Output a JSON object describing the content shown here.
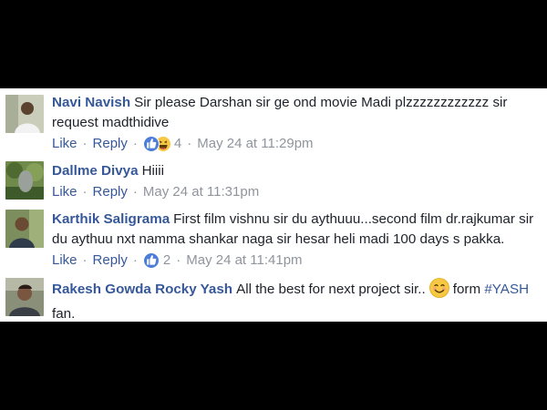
{
  "comments": [
    {
      "author": "Navi Navish",
      "text": "Sir please Darshan sir ge ond movie Madi plzzzzzzzzzzzz sir request madthidive",
      "like": "Like",
      "reply": "Reply",
      "reactions": [
        "like-icon",
        "haha-icon"
      ],
      "reaction_count": "4",
      "time": "May 24 at 11:29pm"
    },
    {
      "author": "Dallme Divya",
      "text": "Hiiii",
      "like": "Like",
      "reply": "Reply",
      "time": "May 24 at 11:31pm"
    },
    {
      "author": "Karthik Saligrama",
      "text": "First film vishnu sir du aythuuu...second film dr.rajkumar sir du aythuu nxt namma shankar naga sir hesar heli madi 100 days s pakka.",
      "like": "Like",
      "reply": "Reply",
      "reactions": [
        "like-icon"
      ],
      "reaction_count": "2",
      "time": "May 24 at 11:41pm"
    },
    {
      "author": "Rakesh Gowda Rocky Yash",
      "text_before": "All the best for next project sir..",
      "emoji": "smiling-face-icon",
      "text_after": "form",
      "hashtag": "#YASH",
      "text_end": "fan."
    }
  ],
  "colors": {
    "link": "#365899",
    "text": "#1d2129",
    "meta": "#90949c",
    "background": "#000000",
    "panel": "#ffffff"
  }
}
